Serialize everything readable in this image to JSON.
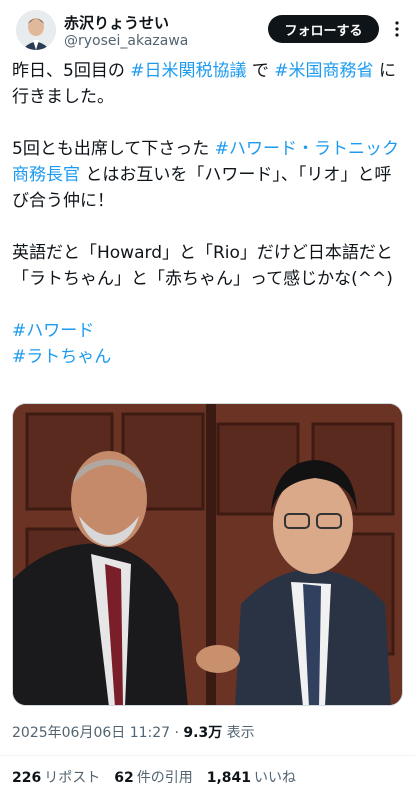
{
  "author": {
    "name": "赤沢りょうせい",
    "handle": "@ryosei_akazawa",
    "follow_label": "フォローする",
    "more_icon": "more-vert-icon"
  },
  "tweet": {
    "p1_a": "昨日、5回目の ",
    "p1_tag1": "#日米関税協議",
    "p1_b": " で ",
    "p1_tag2": "#米国商務省",
    "p1_c": " に行きました。",
    "p2_a": "5回とも出席して下さった ",
    "p2_tag": "#ハワード・ラトニック商務長官",
    "p2_b": " とはお互いを「ハワード」、「リオ」と呼び合う仲に！",
    "p3": "英語だと「Howard」と「Rio」だけど日本語だと「ラトちゃん」と「赤ちゃん」って感じかな(^^)",
    "tag_a": "#ハワード",
    "tag_b": "#ラトちゃん"
  },
  "meta": {
    "datetime": "2025年06月06日 11:27",
    "sep": " · ",
    "views_count": "9.3万",
    "views_label": " 表示"
  },
  "stats": {
    "reposts_count": "226",
    "reposts_label": "リポスト",
    "quotes_count": "62",
    "quotes_label": "件の引用",
    "likes_count": "1,841",
    "likes_label": "いいね"
  },
  "colors": {
    "hashtag": "#1d9bf0",
    "text": "#0f1419",
    "muted": "#536471"
  }
}
